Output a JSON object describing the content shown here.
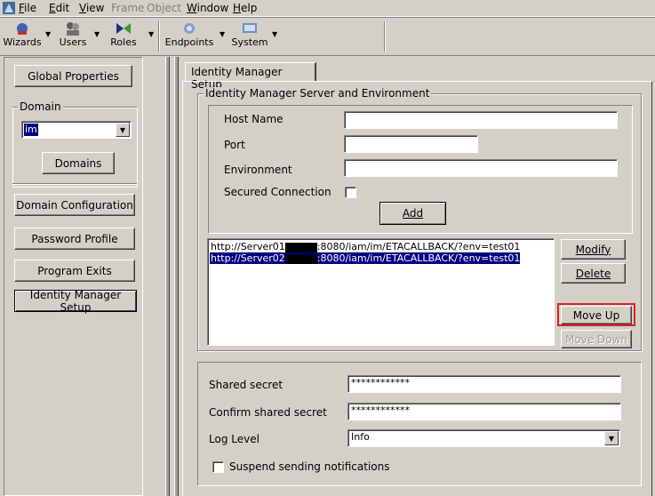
{
  "menubar": {
    "items": [
      {
        "label": "File",
        "u": "F",
        "rest": "ile",
        "disabled": false
      },
      {
        "label": "Edit",
        "u": "E",
        "rest": "dit",
        "disabled": false
      },
      {
        "label": "View",
        "u": "V",
        "rest": "iew",
        "disabled": false
      },
      {
        "label": "Frame",
        "u": "",
        "rest": "Frame",
        "disabled": true
      },
      {
        "label": "Object",
        "u": "",
        "rest": "Object",
        "disabled": true
      },
      {
        "label": "Window",
        "u": "W",
        "rest": "indow",
        "disabled": false
      },
      {
        "label": "Help",
        "u": "H",
        "rest": "elp",
        "disabled": false
      }
    ]
  },
  "toolbar": {
    "wizards": "Wizards",
    "users": "Users",
    "roles": "Roles",
    "endpoints": "Endpoints",
    "system": "System"
  },
  "left_panel": {
    "global_properties": "Global Properties",
    "domain_legend": "Domain",
    "domain_value": "im",
    "domains_button": "Domains",
    "domain_configuration": "Domain Configuration",
    "password_profile": "Password Profile",
    "program_exits": "Program Exits",
    "identity_manager_setup": "Identity Manager Setup"
  },
  "tab": {
    "label": "Identity Manager Setup"
  },
  "server_group": {
    "legend": "Identity Manager Server and Environment",
    "host_name_label": "Host Name",
    "host_name_value": "",
    "port_label": "Port",
    "port_value": "",
    "environment_label": "Environment",
    "environment_value": "",
    "secured_connection_label": "Secured Connection",
    "secured_connection_checked": false,
    "add_button": "Add"
  },
  "server_list": {
    "rows": [
      {
        "prefix": "http://Server01",
        "suffix": ":8080/iam/im/ETACALLBACK/?env=test01",
        "selected": false
      },
      {
        "prefix": "http://Server02",
        "suffix": ":8080/iam/im/ETACALLBACK/?env=test01",
        "selected": true
      }
    ],
    "modify_button": "Modify",
    "delete_button": "Delete",
    "move_up_button": "Move Up",
    "move_down_button": "Move Down"
  },
  "secret_group": {
    "shared_secret_label": "Shared secret",
    "shared_secret_value": "************",
    "confirm_label": "Confirm shared secret",
    "confirm_value": "************",
    "log_level_label": "Log Level",
    "log_level_value": "Info",
    "suspend_label": "Suspend sending notifications",
    "suspend_checked": false
  },
  "colors": {
    "face": "#d4d0c8",
    "selection": "#000080",
    "highlight_box": "#e0202a"
  }
}
